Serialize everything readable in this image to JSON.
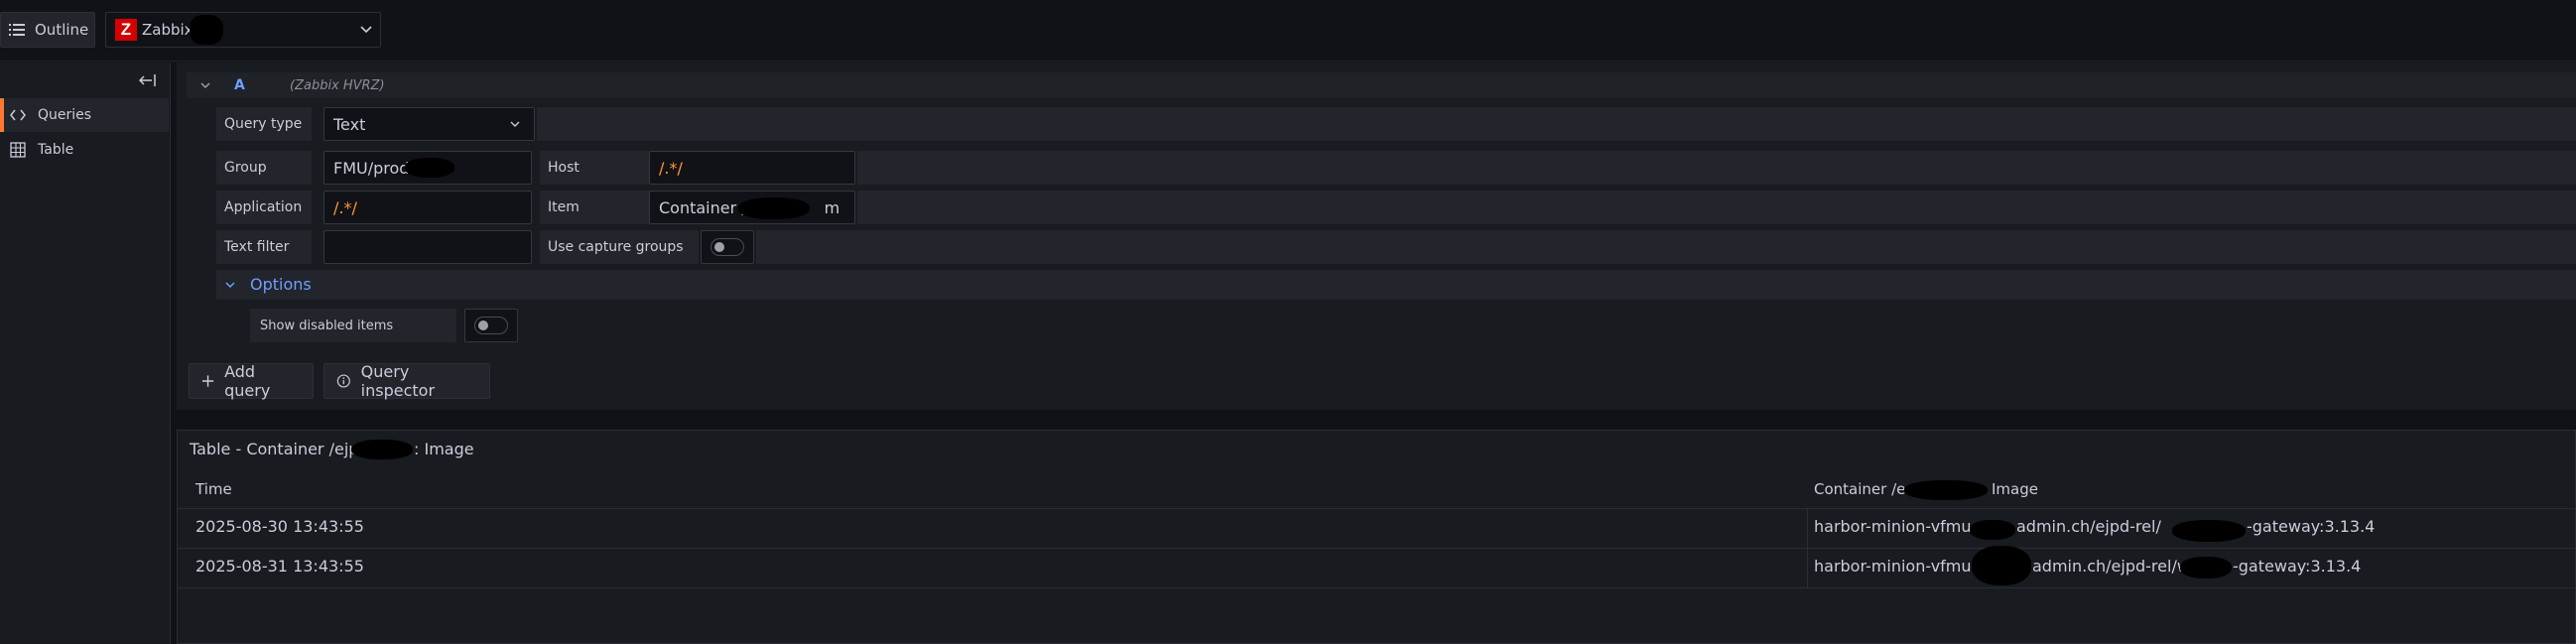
{
  "topbar": {
    "outline_label": "Outline",
    "datasource_name": "Zabbix",
    "datasource_logo_letter": "Z"
  },
  "sidebar": {
    "items": [
      {
        "label": "Queries",
        "icon": "code-icon"
      },
      {
        "label": "Table",
        "icon": "table-icon"
      }
    ]
  },
  "query": {
    "ref_id": "A",
    "datasource_hint": "(Zabbix HVRZ)",
    "query_type_label": "Query type",
    "query_type_value": "Text",
    "group_label": "Group",
    "group_value": "FMU/prod",
    "host_label": "Host",
    "host_value": "/.*/",
    "application_label": "Application",
    "application_value": "/.*/",
    "item_label": "Item",
    "item_value_start": "Container /",
    "item_value_end": "m",
    "text_filter_label": "Text filter",
    "text_filter_value": "",
    "capture_groups_label": "Use capture groups",
    "options_label": "Options",
    "show_disabled_label": "Show disabled items"
  },
  "actions": {
    "add_query": "Add query",
    "query_inspector": "Query inspector"
  },
  "results": {
    "title_start": "Table - Container /ejp",
    "title_end": ": Image",
    "columns": [
      "Time",
      "Container /e",
      "Image"
    ],
    "rows": [
      {
        "time": "2025-08-30 13:43:55",
        "value_a": "harbor-minion-vfmu",
        "value_b": "admin.ch/ejpd-rel/",
        "value_c": "-gateway:3.13.4"
      },
      {
        "time": "2025-08-31 13:43:55",
        "value_a": "harbor-minion-vfmu.",
        "value_b": "admin.ch/ejpd-rel/w",
        "value_c": "-gateway:3.13.4"
      }
    ]
  },
  "colors": {
    "accent": "#6e9fff",
    "regex": "#ff9830",
    "active_marker": "#ff7831",
    "logo": "#d40000"
  }
}
